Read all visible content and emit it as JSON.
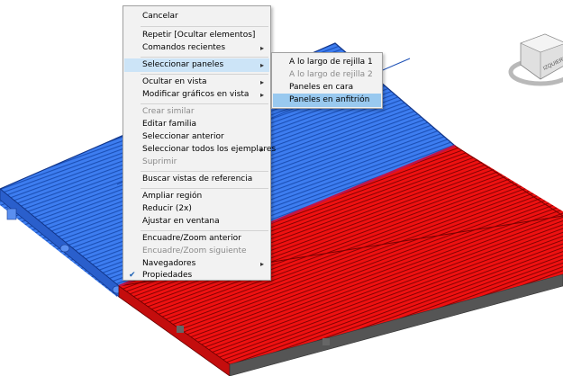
{
  "context_menu": {
    "items": [
      {
        "label": "Cancelar",
        "disabled": false,
        "submenu": false
      },
      {
        "label": "Repetir [Ocultar elementos]",
        "disabled": false,
        "submenu": false
      },
      {
        "label": "Comandos recientes",
        "disabled": false,
        "submenu": true
      },
      {
        "label": "Seleccionar paneles",
        "disabled": false,
        "submenu": true,
        "highlighted": true
      },
      {
        "label": "Ocultar en vista",
        "disabled": false,
        "submenu": true
      },
      {
        "label": "Modificar gráficos en vista",
        "disabled": false,
        "submenu": true
      },
      {
        "label": "Crear similar",
        "disabled": true,
        "submenu": false
      },
      {
        "label": "Editar familia",
        "disabled": false,
        "submenu": false
      },
      {
        "label": "Seleccionar anterior",
        "disabled": false,
        "submenu": false
      },
      {
        "label": "Seleccionar todos los ejemplares",
        "disabled": false,
        "submenu": true
      },
      {
        "label": "Suprimir",
        "disabled": true,
        "submenu": false
      },
      {
        "label": "Buscar vistas de referencia",
        "disabled": false,
        "submenu": false
      },
      {
        "label": "Ampliar región",
        "disabled": false,
        "submenu": false
      },
      {
        "label": "Reducir (2x)",
        "disabled": false,
        "submenu": false
      },
      {
        "label": "Ajustar en ventana",
        "disabled": false,
        "submenu": false
      },
      {
        "label": "Encuadre/Zoom anterior",
        "disabled": false,
        "submenu": false
      },
      {
        "label": "Encuadre/Zoom siguiente",
        "disabled": true,
        "submenu": false
      },
      {
        "label": "Navegadores",
        "disabled": false,
        "submenu": true
      },
      {
        "label": "Propiedades",
        "disabled": false,
        "submenu": false,
        "checked": true
      }
    ]
  },
  "submenu": {
    "items": [
      {
        "label": "A lo largo de rejilla 1",
        "disabled": false
      },
      {
        "label": "A lo largo de rejilla 2",
        "disabled": true
      },
      {
        "label": "Paneles en cara",
        "disabled": false
      },
      {
        "label": "Paneles en anfitrión",
        "disabled": false,
        "highlighted": true
      }
    ]
  },
  "viewcube": {
    "label": "IZQUIERDA"
  },
  "colors": {
    "selected_panels": "#2f6fe0",
    "highlighted_panels": "#e81010",
    "menu_background": "#f2f2f2",
    "menu_hover": "#cce4f7"
  },
  "icons": {
    "arrow": "▸",
    "check": "✔"
  }
}
